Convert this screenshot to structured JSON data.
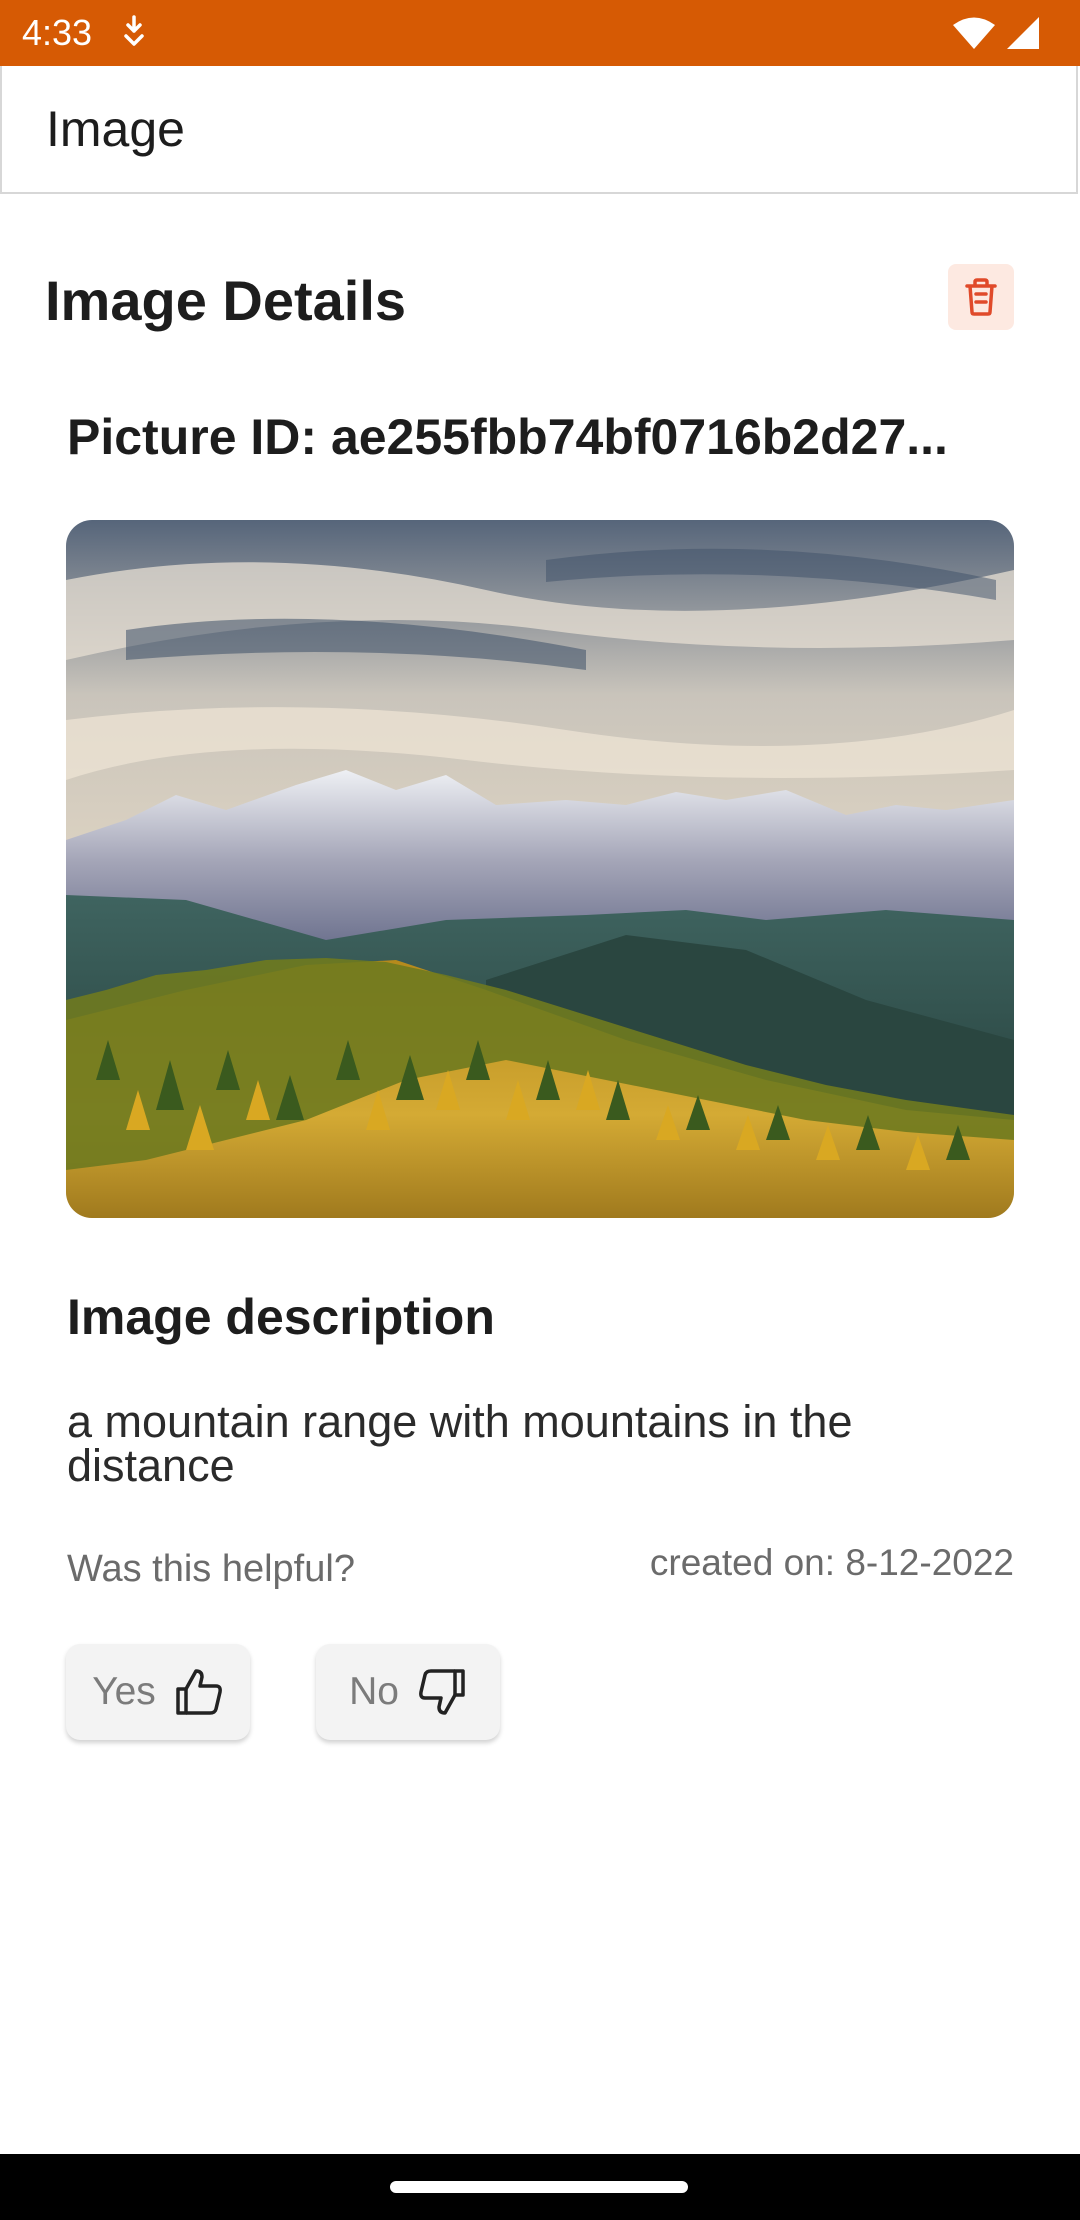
{
  "status_bar": {
    "time": "4:33",
    "background": "#d65a04",
    "icons": [
      "download-icon",
      "wifi-icon",
      "signal-icon"
    ]
  },
  "app_bar": {
    "title": "Image"
  },
  "details": {
    "title": "Image Details",
    "delete_icon": "trash-icon",
    "picture_id": "Picture ID: ae255fbb74bf0716b2d27..."
  },
  "photo": {
    "subject": "mountain-landscape"
  },
  "description": {
    "heading": "Image description",
    "text": "a mountain range with mountains in the distance"
  },
  "feedback": {
    "question": "Was this helpful?",
    "created": "created on: 8-12-2022",
    "yes_label": "Yes",
    "yes_icon": "thumbs-up-icon",
    "no_label": "No",
    "no_icon": "thumbs-down-icon"
  },
  "colors": {
    "accent": "#d65a04",
    "delete_bg": "#fde9e1",
    "delete_fg": "#e04a2a"
  }
}
